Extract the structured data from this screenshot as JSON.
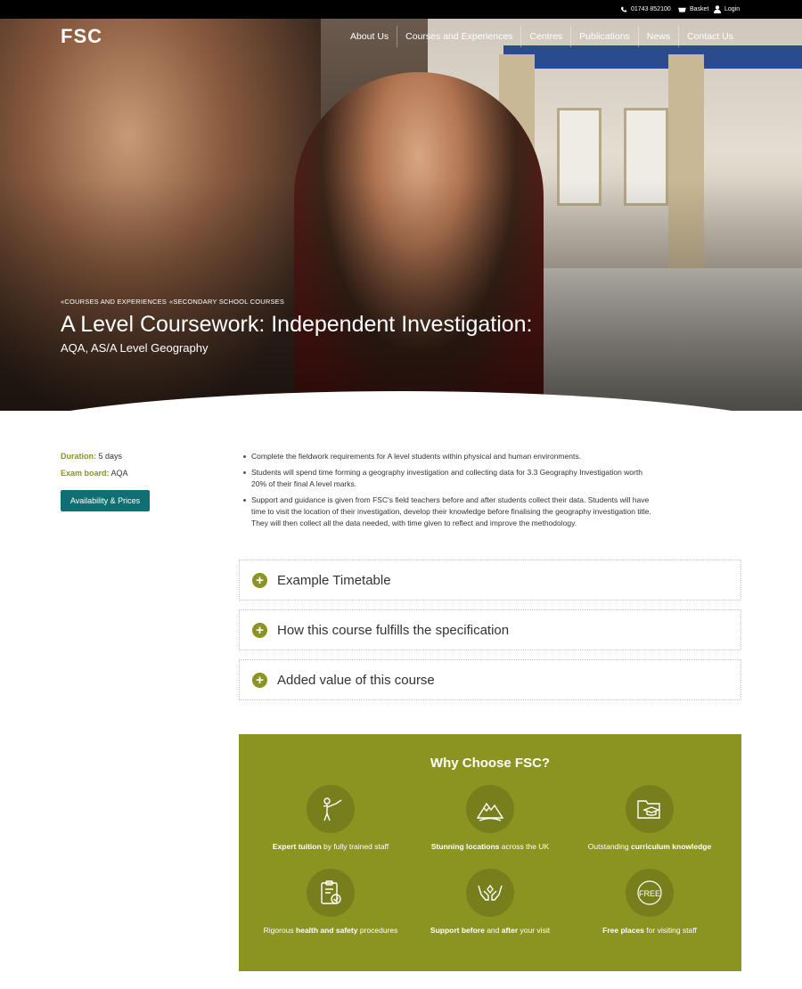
{
  "topbar": {
    "phone": "01743 852100",
    "basket": "Basket",
    "login": "Login"
  },
  "header": {
    "logo": "FSC",
    "nav": [
      "About Us",
      "Courses and Experiences",
      "Centres",
      "Publications",
      "News",
      "Contact Us"
    ]
  },
  "hero": {
    "breadcrumb": [
      "«COURSES AND EXPERIENCES",
      "«SECONDARY SCHOOL COURSES"
    ],
    "title": "A Level Coursework: Independent Investigation:",
    "subtitle": "AQA, AS/A Level Geography"
  },
  "course_info": {
    "duration_label": "Duration:",
    "duration_value": "5 days",
    "exam_label": "Exam board:",
    "exam_value": "AQA",
    "availability_button": "Availability & Prices"
  },
  "description": [
    "Complete the fieldwork requirements for A level students within physical and human environments.",
    "Students will spend time forming a geography investigation and collecting data for 3.3 Geography Investigation worth 20% of their final A level marks.",
    "Support and guidance is given from FSC's field teachers before and after students collect their data. Students will have time to visit the location of their investigation, develop their knowledge before finalising the geography investigation title. They will then collect all the data needed, with time given to reflect and improve the methodology."
  ],
  "accordions": [
    "Example Timetable",
    "How this course fulfills the specification",
    "Added value of this course"
  ],
  "why_choose": {
    "title": "Why Choose FSC?",
    "features": [
      {
        "icon": "teacher-icon",
        "pre": "",
        "bold": "Expert tuition",
        "post": " by fully trained staff"
      },
      {
        "icon": "mountain-icon",
        "pre": "",
        "bold": "Stunning locations",
        "post": " across the UK"
      },
      {
        "icon": "folder-graduation-icon",
        "pre": "Outstanding ",
        "bold": "curriculum knowledge",
        "post": ""
      },
      {
        "icon": "clipboard-check-icon",
        "pre": "Rigorous ",
        "bold": "health and safety",
        "post": " procedures"
      },
      {
        "icon": "supporting-hands-icon",
        "pre": "",
        "bold": "Support before",
        "post": " and ",
        "bold2": "after",
        "post2": " your visit"
      },
      {
        "icon": "free-badge-icon",
        "pre": "",
        "bold": "Free places",
        "post": " for visiting staff",
        "badge": "FREE"
      }
    ]
  },
  "colors": {
    "accent": "#8b9421",
    "button": "#0f6f72",
    "topbar": "#000000"
  }
}
